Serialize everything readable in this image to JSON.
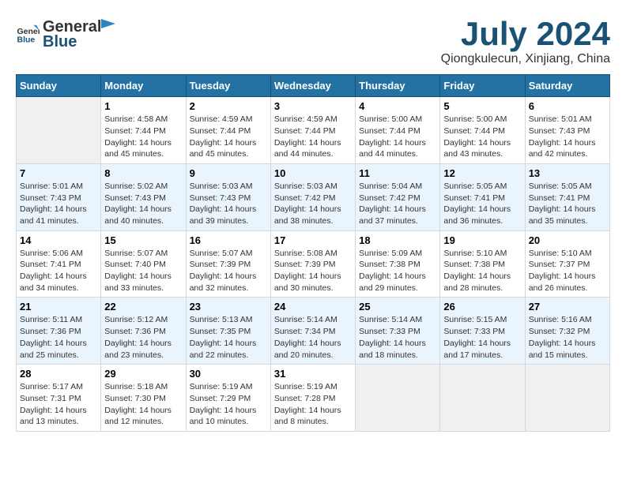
{
  "logo": {
    "text_general": "General",
    "text_blue": "Blue"
  },
  "title": "July 2024",
  "subtitle": "Qiongkulecun, Xinjiang, China",
  "days_of_week": [
    "Sunday",
    "Monday",
    "Tuesday",
    "Wednesday",
    "Thursday",
    "Friday",
    "Saturday"
  ],
  "weeks": [
    [
      {
        "day": "",
        "info": ""
      },
      {
        "day": "1",
        "info": "Sunrise: 4:58 AM\nSunset: 7:44 PM\nDaylight: 14 hours\nand 45 minutes."
      },
      {
        "day": "2",
        "info": "Sunrise: 4:59 AM\nSunset: 7:44 PM\nDaylight: 14 hours\nand 45 minutes."
      },
      {
        "day": "3",
        "info": "Sunrise: 4:59 AM\nSunset: 7:44 PM\nDaylight: 14 hours\nand 44 minutes."
      },
      {
        "day": "4",
        "info": "Sunrise: 5:00 AM\nSunset: 7:44 PM\nDaylight: 14 hours\nand 44 minutes."
      },
      {
        "day": "5",
        "info": "Sunrise: 5:00 AM\nSunset: 7:44 PM\nDaylight: 14 hours\nand 43 minutes."
      },
      {
        "day": "6",
        "info": "Sunrise: 5:01 AM\nSunset: 7:43 PM\nDaylight: 14 hours\nand 42 minutes."
      }
    ],
    [
      {
        "day": "7",
        "info": "Sunrise: 5:01 AM\nSunset: 7:43 PM\nDaylight: 14 hours\nand 41 minutes."
      },
      {
        "day": "8",
        "info": "Sunrise: 5:02 AM\nSunset: 7:43 PM\nDaylight: 14 hours\nand 40 minutes."
      },
      {
        "day": "9",
        "info": "Sunrise: 5:03 AM\nSunset: 7:43 PM\nDaylight: 14 hours\nand 39 minutes."
      },
      {
        "day": "10",
        "info": "Sunrise: 5:03 AM\nSunset: 7:42 PM\nDaylight: 14 hours\nand 38 minutes."
      },
      {
        "day": "11",
        "info": "Sunrise: 5:04 AM\nSunset: 7:42 PM\nDaylight: 14 hours\nand 37 minutes."
      },
      {
        "day": "12",
        "info": "Sunrise: 5:05 AM\nSunset: 7:41 PM\nDaylight: 14 hours\nand 36 minutes."
      },
      {
        "day": "13",
        "info": "Sunrise: 5:05 AM\nSunset: 7:41 PM\nDaylight: 14 hours\nand 35 minutes."
      }
    ],
    [
      {
        "day": "14",
        "info": "Sunrise: 5:06 AM\nSunset: 7:41 PM\nDaylight: 14 hours\nand 34 minutes."
      },
      {
        "day": "15",
        "info": "Sunrise: 5:07 AM\nSunset: 7:40 PM\nDaylight: 14 hours\nand 33 minutes."
      },
      {
        "day": "16",
        "info": "Sunrise: 5:07 AM\nSunset: 7:39 PM\nDaylight: 14 hours\nand 32 minutes."
      },
      {
        "day": "17",
        "info": "Sunrise: 5:08 AM\nSunset: 7:39 PM\nDaylight: 14 hours\nand 30 minutes."
      },
      {
        "day": "18",
        "info": "Sunrise: 5:09 AM\nSunset: 7:38 PM\nDaylight: 14 hours\nand 29 minutes."
      },
      {
        "day": "19",
        "info": "Sunrise: 5:10 AM\nSunset: 7:38 PM\nDaylight: 14 hours\nand 28 minutes."
      },
      {
        "day": "20",
        "info": "Sunrise: 5:10 AM\nSunset: 7:37 PM\nDaylight: 14 hours\nand 26 minutes."
      }
    ],
    [
      {
        "day": "21",
        "info": "Sunrise: 5:11 AM\nSunset: 7:36 PM\nDaylight: 14 hours\nand 25 minutes."
      },
      {
        "day": "22",
        "info": "Sunrise: 5:12 AM\nSunset: 7:36 PM\nDaylight: 14 hours\nand 23 minutes."
      },
      {
        "day": "23",
        "info": "Sunrise: 5:13 AM\nSunset: 7:35 PM\nDaylight: 14 hours\nand 22 minutes."
      },
      {
        "day": "24",
        "info": "Sunrise: 5:14 AM\nSunset: 7:34 PM\nDaylight: 14 hours\nand 20 minutes."
      },
      {
        "day": "25",
        "info": "Sunrise: 5:14 AM\nSunset: 7:33 PM\nDaylight: 14 hours\nand 18 minutes."
      },
      {
        "day": "26",
        "info": "Sunrise: 5:15 AM\nSunset: 7:33 PM\nDaylight: 14 hours\nand 17 minutes."
      },
      {
        "day": "27",
        "info": "Sunrise: 5:16 AM\nSunset: 7:32 PM\nDaylight: 14 hours\nand 15 minutes."
      }
    ],
    [
      {
        "day": "28",
        "info": "Sunrise: 5:17 AM\nSunset: 7:31 PM\nDaylight: 14 hours\nand 13 minutes."
      },
      {
        "day": "29",
        "info": "Sunrise: 5:18 AM\nSunset: 7:30 PM\nDaylight: 14 hours\nand 12 minutes."
      },
      {
        "day": "30",
        "info": "Sunrise: 5:19 AM\nSunset: 7:29 PM\nDaylight: 14 hours\nand 10 minutes."
      },
      {
        "day": "31",
        "info": "Sunrise: 5:19 AM\nSunset: 7:28 PM\nDaylight: 14 hours\nand 8 minutes."
      },
      {
        "day": "",
        "info": ""
      },
      {
        "day": "",
        "info": ""
      },
      {
        "day": "",
        "info": ""
      }
    ]
  ]
}
